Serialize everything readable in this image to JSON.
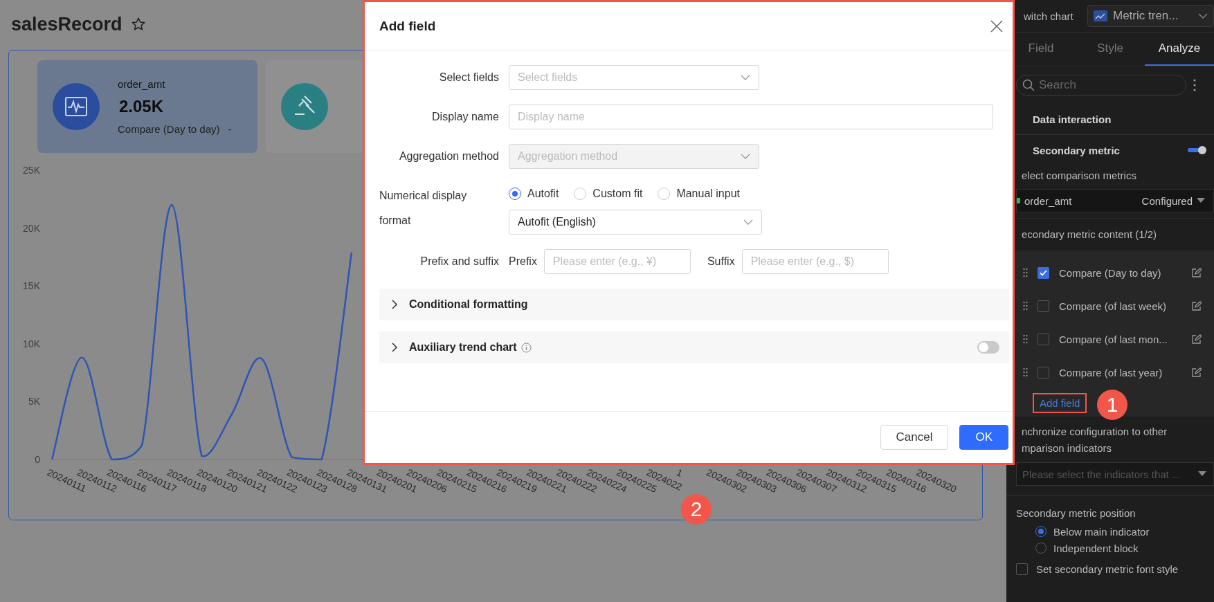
{
  "page": {
    "title": "salesRecord",
    "kpi": {
      "name": "order_amt",
      "value": "2.05K",
      "compare_label": "Compare (Day to day)",
      "compare_value": "-"
    },
    "chart_data": {
      "type": "line",
      "categories": [
        "20240111",
        "20240112",
        "20240116",
        "20240117",
        "20240118",
        "20240120",
        "20240121",
        "20240122",
        "20240123",
        "20240128",
        "20240131",
        "20240201",
        "20240206",
        "20240215",
        "20240216",
        "20240219",
        "20240221",
        "20240222",
        "20240224",
        "20240225",
        "2024022",
        "1",
        "20240302",
        "20240303",
        "20240306",
        "20240307",
        "20240312",
        "20240315",
        "20240316",
        "20240320"
      ],
      "series": [
        {
          "color": "#2f54b3",
          "values": [
            0,
            8800,
            0,
            1200,
            22000,
            300,
            3900,
            8700,
            200,
            0,
            17900,
            null,
            null,
            null,
            null,
            null,
            null,
            null,
            null,
            null,
            null,
            null,
            null,
            null,
            null,
            null,
            null,
            null,
            null,
            null
          ]
        }
      ],
      "yticks": [
        0,
        {
          "value": 5000,
          "label": "5K"
        },
        {
          "value": 10000,
          "label": "10K"
        },
        {
          "value": 15000,
          "label": "15K"
        },
        {
          "value": 20000,
          "label": "20K"
        },
        {
          "value": 25000,
          "label": "25K"
        }
      ],
      "ylim": [
        0,
        25000
      ]
    }
  },
  "dialog": {
    "title": "Add field",
    "fields": [
      {
        "kind": "select",
        "label": "Select fields",
        "placeholder": "Select fields",
        "disabled": false
      },
      {
        "kind": "input",
        "label": "Display name",
        "placeholder": "Display name",
        "disabled": false
      },
      {
        "kind": "select",
        "label": "Aggregation method",
        "placeholder": "Aggregation method",
        "disabled": true
      }
    ],
    "format": {
      "label": "Numerical display format",
      "options": [
        {
          "label": "Autofit",
          "selected": true
        },
        {
          "label": "Custom fit",
          "selected": false
        },
        {
          "label": "Manual input",
          "selected": false
        }
      ],
      "value": "Autofit (English)"
    },
    "affix": {
      "label": "Prefix and suffix",
      "prefix_label": "Prefix",
      "prefix_placeholder": "Please enter (e.g., ¥)",
      "suffix_label": "Suffix",
      "suffix_placeholder": "Please enter (e.g., $)"
    },
    "sections": [
      {
        "kind": "plain",
        "title": "Conditional formatting",
        "expanded": false
      },
      {
        "kind": "toggle",
        "title": "Auxiliary trend chart",
        "expanded": false,
        "on": false
      }
    ],
    "buttons": [
      {
        "kind": "default",
        "label": "Cancel"
      },
      {
        "kind": "primary",
        "label": "OK"
      }
    ]
  },
  "sidebar": {
    "switch_label": "witch chart",
    "chart_type": "Metric tren...",
    "tabs": [
      {
        "label": "Field",
        "selected": false
      },
      {
        "label": "Style",
        "selected": false
      },
      {
        "label": "Analyze",
        "selected": true
      }
    ],
    "search_placeholder": "Search",
    "data_interaction": "Data interaction",
    "secondary_metric": {
      "label": "Secondary metric",
      "on": true
    },
    "comparison_label": "elect comparison metrics",
    "comparison_select": {
      "value": "order_amt",
      "status": "Configured"
    },
    "content_label": "econdary metric content (1/2)",
    "content_items": [
      {
        "label": "Compare (Day to day)",
        "checked": true
      },
      {
        "label": "Compare (of last week)",
        "checked": false
      },
      {
        "label": "Compare (of last mon...",
        "checked": false
      },
      {
        "label": "Compare (of last year)",
        "checked": false
      }
    ],
    "add_field": "Add field",
    "sync_label": [
      "nchronize configuration to other",
      "mparison indicators"
    ],
    "sync_placeholder": "Please select the indicators that ...",
    "position": {
      "label": "Secondary metric position",
      "options": [
        {
          "label": "Below main indicator",
          "selected": true
        },
        {
          "label": "Independent block",
          "selected": false
        }
      ]
    },
    "font_style": {
      "label": "Set secondary metric font style",
      "checked": false
    }
  },
  "annotations": [
    {
      "label": "1"
    },
    {
      "label": "2"
    }
  ]
}
